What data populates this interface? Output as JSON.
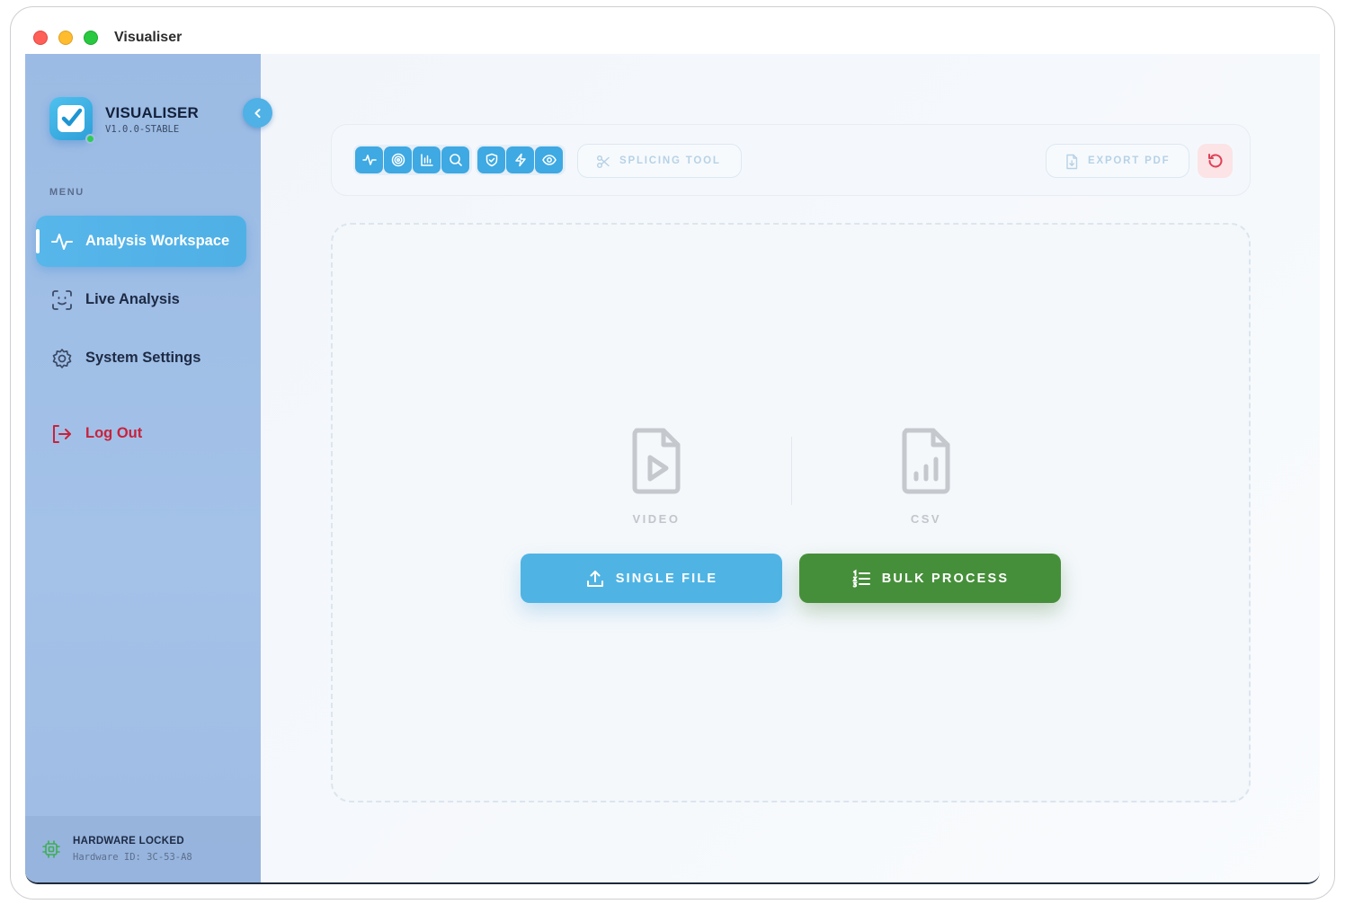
{
  "window": {
    "title": "Visualiser"
  },
  "brand": {
    "name": "VISUALISER",
    "version": "V1.0.0-STABLE"
  },
  "sidebar": {
    "menu_label": "MENU",
    "items": [
      {
        "label": "Analysis Workspace",
        "icon": "activity-icon",
        "active": true
      },
      {
        "label": "Live Analysis",
        "icon": "face-scan-icon",
        "active": false
      },
      {
        "label": "System Settings",
        "icon": "gear-icon",
        "active": false
      }
    ],
    "logout_label": "Log Out",
    "hardware": {
      "title": "HARDWARE LOCKED",
      "id": "Hardware ID: 3C-53-A8"
    }
  },
  "toolbar": {
    "tool_icons_group_a": [
      "activity-icon",
      "target-icon",
      "bar-chart-icon",
      "search-icon"
    ],
    "tool_icons_group_b": [
      "shield-check-icon",
      "zap-icon",
      "eye-icon"
    ],
    "splicing_label": "SPLICING TOOL",
    "export_label": "EXPORT PDF"
  },
  "dropzone": {
    "types": [
      "VIDEO",
      "CSV"
    ],
    "single_label": "SINGLE FILE",
    "bulk_label": "BULK PROCESS"
  },
  "colors": {
    "accent_blue": "#4fb4e4",
    "bulk_green": "#468f3a",
    "logout_red": "#c8223c",
    "status_green": "#2ecc55"
  }
}
